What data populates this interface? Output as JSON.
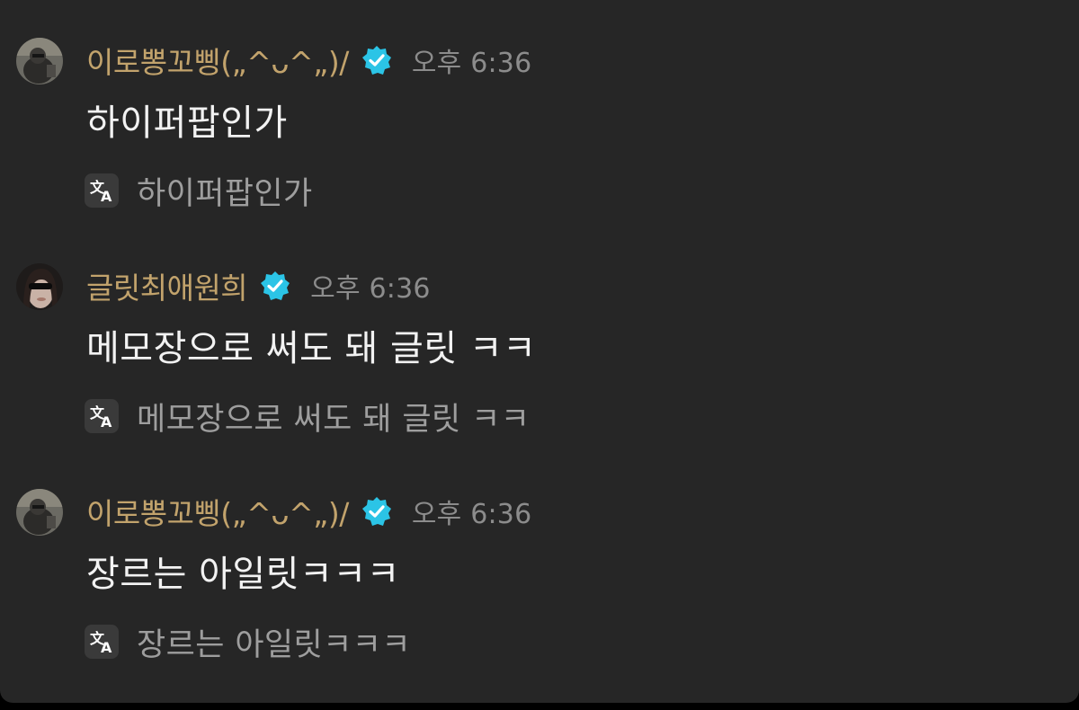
{
  "colors": {
    "background": "#262626",
    "username": "#c2a36c",
    "timestamp": "#8c8c8c",
    "message": "#f2f2f2",
    "translation": "#9e9e9e",
    "verified_badge": "#2bc4e6"
  },
  "messages": [
    {
      "username": "이로뽕꼬삥(„^ᴗ^„)/",
      "verified_icon": "verified-badge-icon",
      "time": "오후 6:36",
      "text": "하이퍼팝인가",
      "translate_icon": "translate-icon",
      "translation": "하이퍼팝인가"
    },
    {
      "username": "글릿최애원희",
      "verified_icon": "verified-badge-icon",
      "time": "오후 6:36",
      "text": "메모장으로 써도 돼 글릿 ㅋㅋ",
      "translate_icon": "translate-icon",
      "translation": "메모장으로 써도 돼 글릿 ㅋㅋ"
    },
    {
      "username": "이로뽕꼬삥(„^ᴗ^„)/",
      "verified_icon": "verified-badge-icon",
      "time": "오후 6:36",
      "text": "장르는 아일릿ㅋㅋㅋ",
      "translate_icon": "translate-icon",
      "translation": "장르는 아일릿ㅋㅋㅋ"
    }
  ]
}
